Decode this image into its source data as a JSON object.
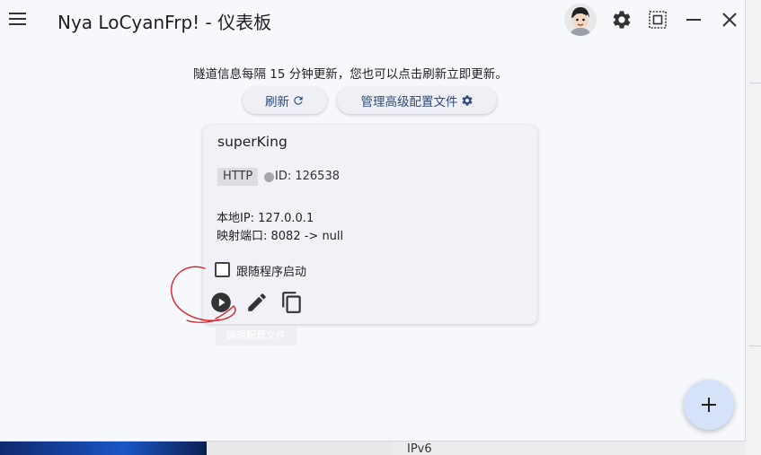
{
  "window": {
    "title": "Nya LoCyanFrp! - 仪表板"
  },
  "titlebar": {
    "icons": [
      "menu-icon",
      "avatar",
      "gear-icon",
      "screenshot-icon",
      "minimize-icon",
      "close-icon"
    ]
  },
  "dashboard": {
    "info_text": "隧道信息每隔 15 分钟更新，您也可以点击刷新立即更新。",
    "refresh_label": "刷新",
    "advanced_label": "管理高级配置文件"
  },
  "tunnel": {
    "name": "superKing",
    "protocol": "HTTP",
    "id_text": "ID: 126538",
    "local_ip": "本地IP: 127.0.0.1",
    "port_map": "映射端口: 8082 -> null",
    "autostart_label": "跟随程序启动",
    "autostart_checked": false,
    "status_color": "#a7a7ab"
  },
  "faded_label": "编辑配置文件",
  "background": {
    "panel_text": "IPv6"
  },
  "colors": {
    "accent": "#2f4a7a",
    "fab": "#d6e2f7",
    "annotation": "#d8232a"
  }
}
